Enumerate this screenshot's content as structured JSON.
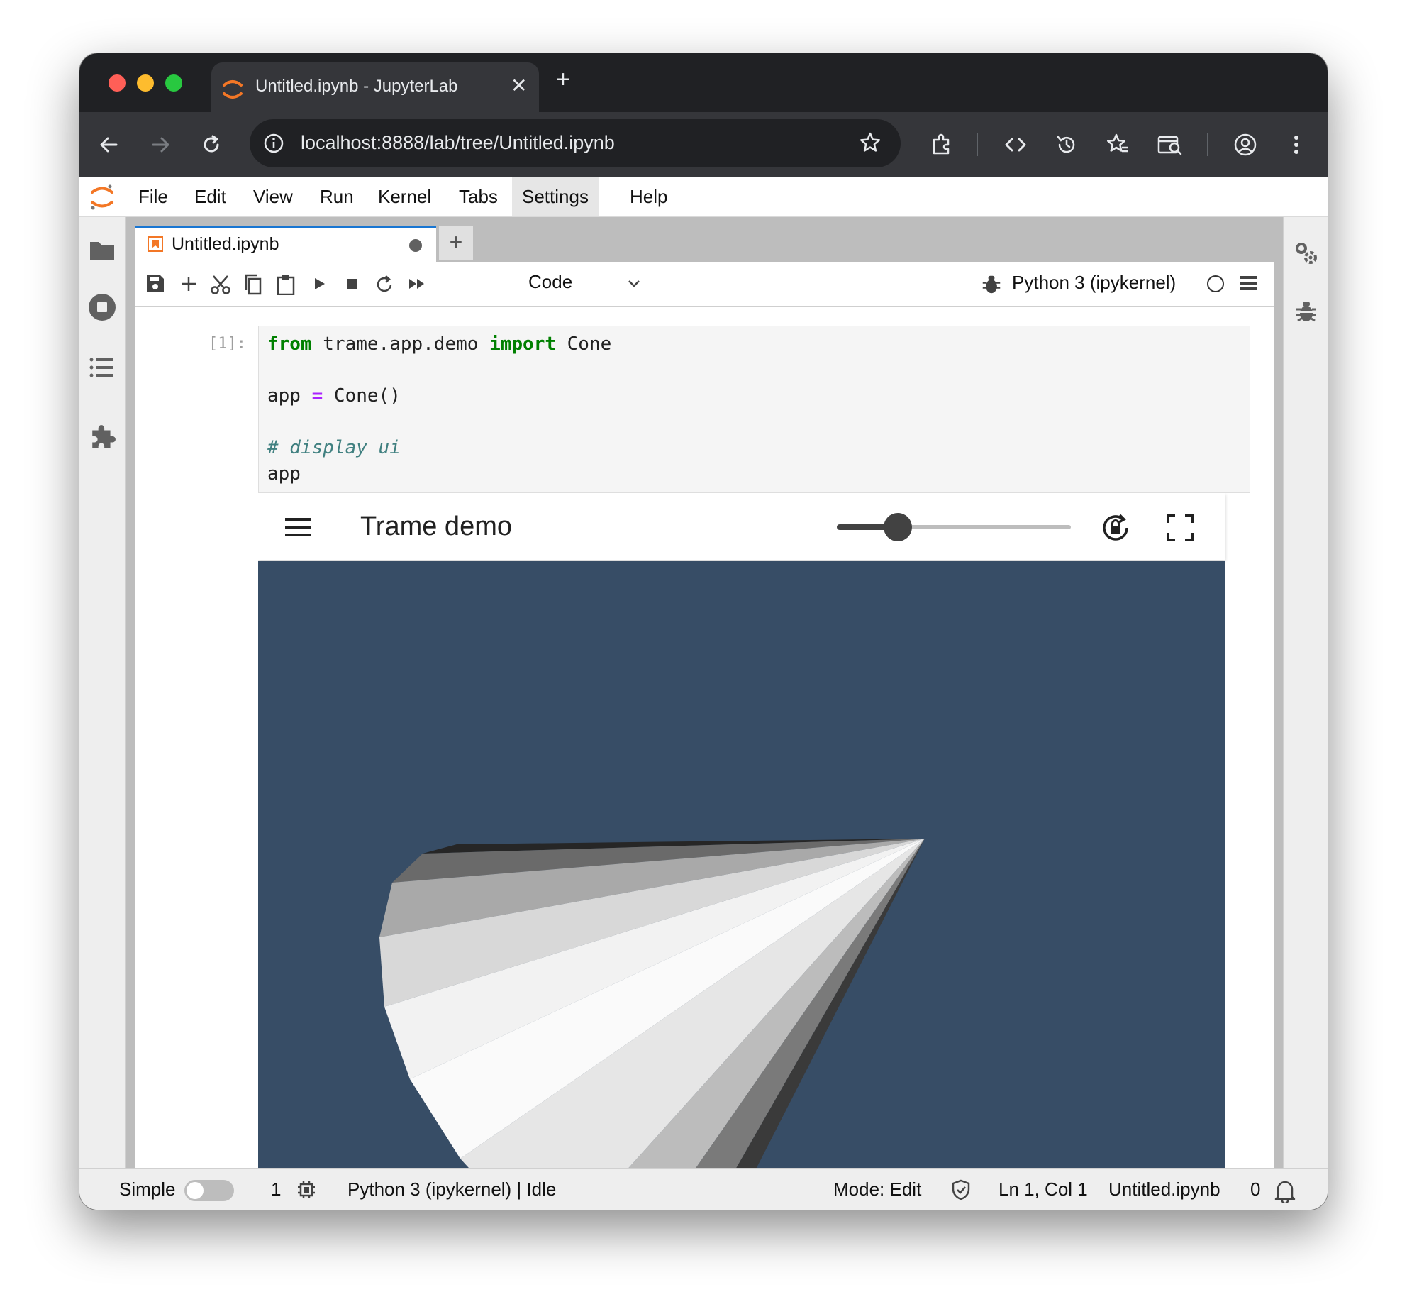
{
  "browser": {
    "tab_title": "Untitled.ipynb - JupyterLab",
    "url": "localhost:8888/lab/tree/Untitled.ipynb"
  },
  "menu": [
    "File",
    "Edit",
    "View",
    "Run",
    "Kernel",
    "Tabs",
    "Settings",
    "Help"
  ],
  "notebook": {
    "tab_title": "Untitled.ipynb",
    "cell_type": "Code",
    "kernel_name": "Python 3 (ipykernel)",
    "prompt": "[1]:",
    "code": {
      "l1_kw1": "from",
      "l1_mod": " trame.app.demo ",
      "l1_kw2": "import",
      "l1_name": " Cone",
      "l2_a": "app ",
      "l2_op": "=",
      "l2_b": " Cone()",
      "l3_comment": "# display ui",
      "l4": "app"
    }
  },
  "trame": {
    "title": "Trame demo",
    "slider_fraction": 0.26,
    "background": "#374d66"
  },
  "status": {
    "mode_label": "Simple",
    "terminals": "1",
    "kernel_status": "Python 3 (ipykernel) | Idle",
    "editor_mode": "Mode: Edit",
    "cursor": "Ln 1, Col 1",
    "file": "Untitled.ipynb",
    "notifications": "0"
  },
  "colors": {
    "accent": "#1976d2",
    "jupyter_orange": "#f37726",
    "chrome_dark": "#202124"
  }
}
